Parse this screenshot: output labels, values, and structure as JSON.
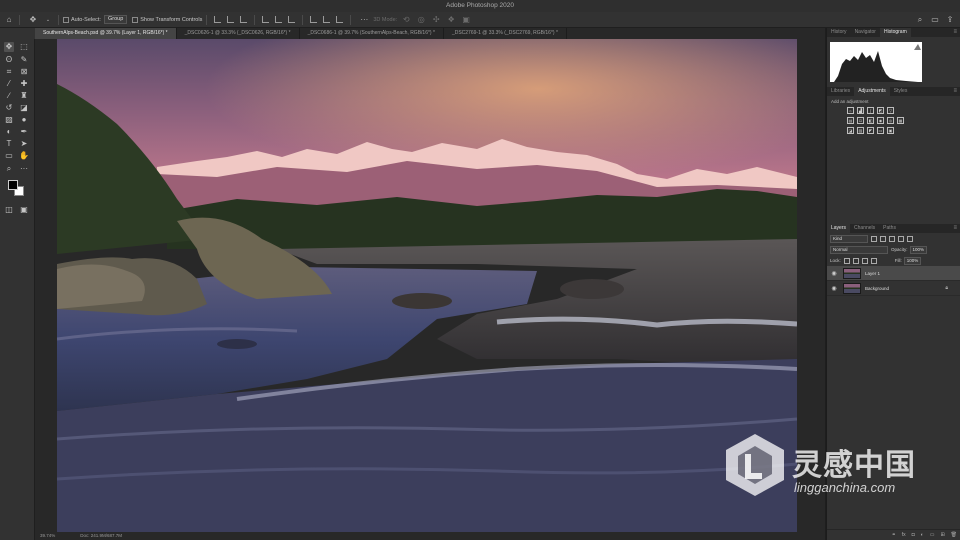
{
  "app": {
    "title": "Adobe Photoshop 2020"
  },
  "options_bar": {
    "auto_select_label": "Auto-Select:",
    "auto_select_target": "Group",
    "transform_label": "Show Transform Controls",
    "mode_label": "3D Mode:"
  },
  "tabs": [
    {
      "label": "SouthernAlps-Beach.psd @ 39.7% (Layer 1, RGB/16*) *"
    },
    {
      "label": "_DSC0626-1 @ 33.3% (_DSC0626, RGB/16*) *"
    },
    {
      "label": "_DSC0686-1 @ 39.7% (SouthernAlps-Beach, RGB/16*) *"
    },
    {
      "label": "_DSC2769-1 @ 33.3% (_DSC2769, RGB/16*) *"
    }
  ],
  "status": {
    "zoom": "39.74%",
    "doc": "Doc: 241.9M/687.7M"
  },
  "panels": {
    "top_tabs": [
      "History",
      "Navigator",
      "Histogram"
    ],
    "mid_tabs": [
      "Libraries",
      "Adjustments",
      "Styles"
    ],
    "adjustments_title": "Add an adjustment",
    "layer_tabs": [
      "Layers",
      "Channels",
      "Paths"
    ],
    "kind_label": "Kind",
    "blend_mode": "Normal",
    "opacity_label": "Opacity:",
    "opacity_value": "100%",
    "lock_label": "Lock:",
    "fill_label": "Fill:",
    "fill_value": "100%",
    "layers": [
      {
        "name": "Layer 1"
      },
      {
        "name": "Background"
      }
    ]
  },
  "watermark": {
    "cn": "灵感中国",
    "en": "lingganchina.com"
  },
  "colors": {
    "foreground": "#000000",
    "background": "#ffffff",
    "accent": "#4a4a4a"
  },
  "icons": [
    "home-icon",
    "move-icon",
    "search-icon",
    "workspace-icon",
    "share-icon",
    "eye-icon",
    "lock-icon",
    "fx-icon",
    "trash-icon"
  ]
}
